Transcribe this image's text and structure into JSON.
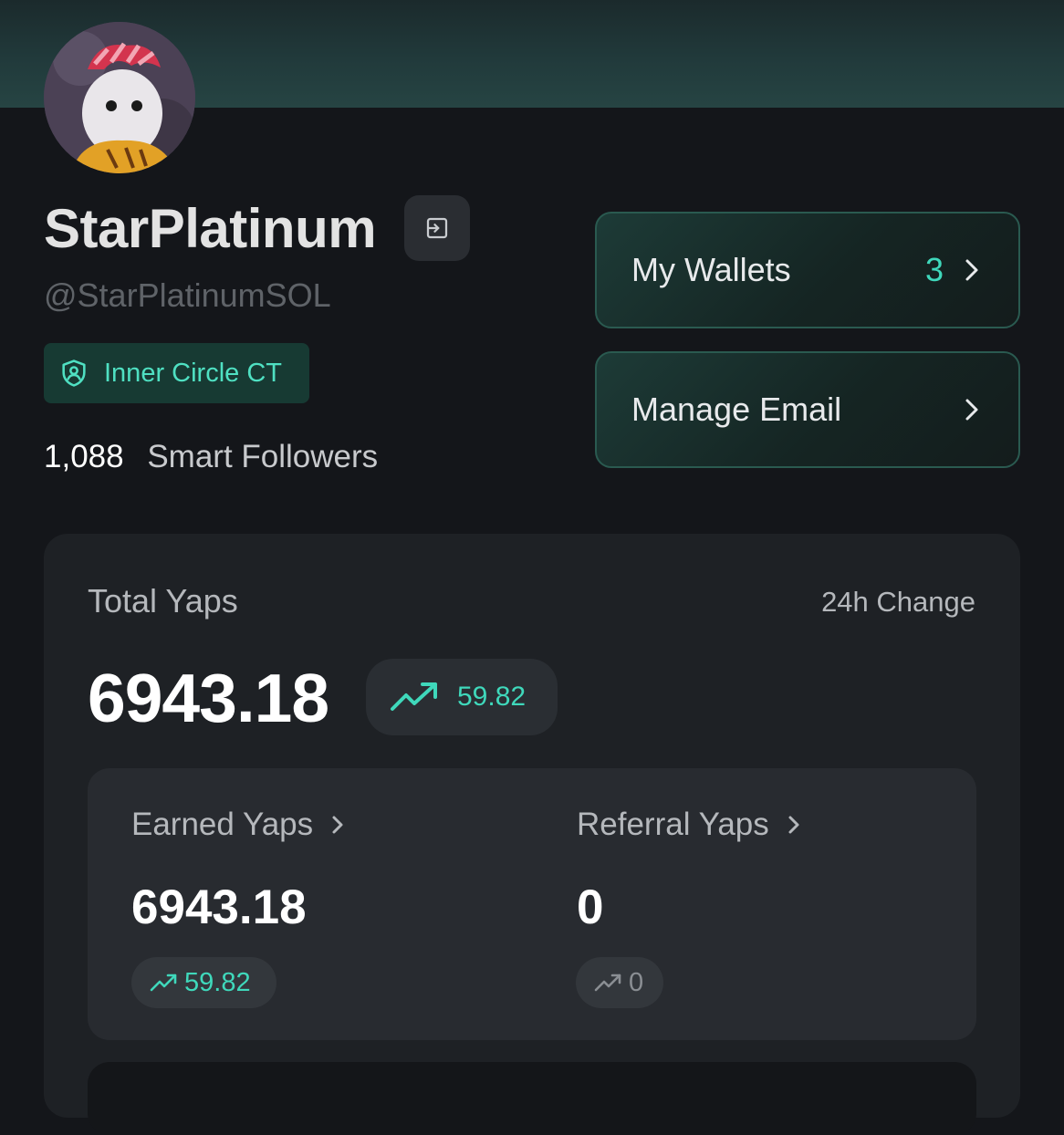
{
  "profile": {
    "name": "StarPlatinum",
    "handle": "@StarPlatinumSOL",
    "badge": "Inner Circle CT",
    "followers_count": "1,088",
    "followers_label": "Smart Followers"
  },
  "actions": {
    "wallets_label": "My Wallets",
    "wallets_count": "3",
    "email_label": "Manage Email"
  },
  "yaps": {
    "total_label": "Total Yaps",
    "change_label": "24h Change",
    "total_value": "6943.18",
    "total_change": "59.82",
    "earned_label": "Earned Yaps",
    "earned_value": "6943.18",
    "earned_change": "59.82",
    "referral_label": "Referral Yaps",
    "referral_value": "0",
    "referral_change": "0"
  },
  "colors": {
    "accent": "#3fd8bb",
    "background": "#14161a",
    "card": "#1e2125"
  },
  "icons": [
    "logout-icon",
    "shield-user-icon",
    "chevron-right-icon",
    "trending-up-icon"
  ]
}
